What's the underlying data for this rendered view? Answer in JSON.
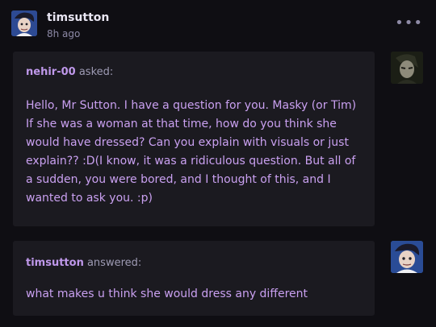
{
  "post": {
    "username": "timsutton",
    "time": "8h ago",
    "more_icon": "more-horizontal-icon"
  },
  "ask": {
    "asker": "nehir-00",
    "verb": "asked:",
    "body": "Hello, Mr Sutton. I have a question for you. Masky (or Tim) If she was a woman at that time, how do you think she would have dressed? Can you explain with visuals or  just explain?? :D(I know, it was a ridiculous question. But all of a sudden, you were bored, and I thought of this, and I wanted to ask you. :p)"
  },
  "answer": {
    "answerer": "timsutton",
    "verb": "answered:",
    "body": "what makes u think she would dress any different"
  },
  "colors": {
    "background": "#0f0e13",
    "bubble": "#1b1a20",
    "accent_text": "#c9a0f0",
    "username": "#e9e6f3"
  }
}
